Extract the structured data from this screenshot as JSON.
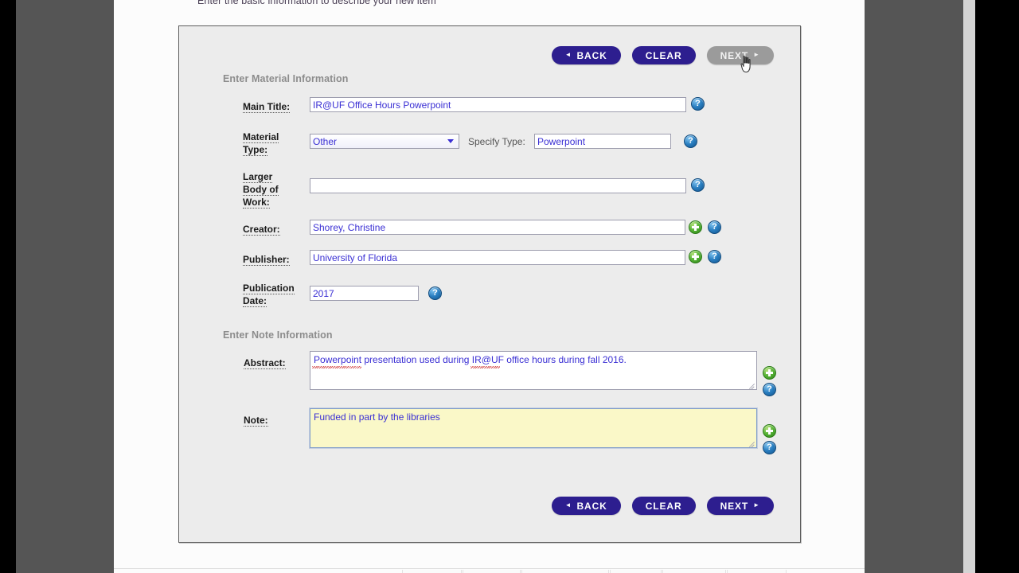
{
  "page": {
    "subtitle": "Enter the basic information to describe your new item"
  },
  "toolbar_top": {
    "back_label": "BACK",
    "clear_label": "CLEAR",
    "next_label": "NEXT",
    "back_arrow": "◄",
    "next_arrow": "►"
  },
  "toolbar_bottom": {
    "back_label": "BACK",
    "clear_label": "CLEAR",
    "next_label": "NEXT",
    "back_arrow": "◄",
    "next_arrow": "►"
  },
  "sections": {
    "material": "Enter Material Information",
    "note": "Enter Note Information"
  },
  "fields": {
    "main_title": {
      "label": "Main Title:",
      "value": "IR@UF Office Hours Powerpoint",
      "help_icon": "help-icon"
    },
    "material_type": {
      "label_line1": "Material",
      "label_line2": "Type:",
      "selected": "Other",
      "options": [
        "Other"
      ],
      "dropdown_icon": "chevron-down-icon",
      "specify_label": "Specify Type:",
      "specify_value": "Powerpoint",
      "help_icon": "help-icon"
    },
    "larger_body": {
      "label_line1": "Larger",
      "label_line2": "Body of",
      "label_line3": "Work:",
      "value": "",
      "placeholder": "",
      "help_icon": "help-icon"
    },
    "creator": {
      "label": "Creator:",
      "value": "Shorey, Christine",
      "add_icon": "add-icon",
      "help_icon": "help-icon"
    },
    "publisher": {
      "label": "Publisher:",
      "value": "University of Florida",
      "add_icon": "add-icon",
      "help_icon": "help-icon"
    },
    "publication_date": {
      "label_line1": "Publication",
      "label_line2": "Date:",
      "value": "2017",
      "help_icon": "help-icon"
    },
    "abstract": {
      "label": "Abstract:",
      "value": "Powerpoint presentation used during IR@UF office hours during fall 2016.",
      "add_icon": "add-icon",
      "help_icon": "help-icon"
    },
    "note": {
      "label": "Note:",
      "value": "Funded in part by the libraries",
      "add_icon": "add-icon",
      "help_icon": "help-icon",
      "focused": true
    }
  },
  "icons": {
    "help_glyph": "?",
    "cursor": "hand-cursor"
  },
  "colors": {
    "button_primary": "#2d1e8f",
    "button_hover": "#9b9b9b",
    "panel_bg": "#ececec",
    "input_text": "#3a2fd4",
    "focused_textarea_bg": "#faf8c8",
    "help_icon": "#2a7fc1",
    "add_icon": "#56b336",
    "section_title": "#8c8c8c",
    "desktop_gray": "#555555"
  }
}
